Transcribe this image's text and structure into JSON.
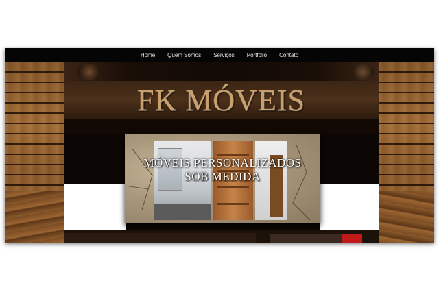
{
  "nav": {
    "items": [
      {
        "label": "Home"
      },
      {
        "label": "Quem Somos"
      },
      {
        "label": "Serviços"
      },
      {
        "label": "Portfólio"
      },
      {
        "label": "Contato"
      }
    ]
  },
  "header": {
    "logo_text": "FK MÓVEIS"
  },
  "hero": {
    "line1": "MÓVEIS PERSONALIZADOS",
    "line2": "SOB MEDIDA"
  },
  "colors": {
    "nav_bg": "#050505",
    "logo_gold": "#c9a06d",
    "wood": "#a56e37",
    "accent_red": "#c11818"
  }
}
